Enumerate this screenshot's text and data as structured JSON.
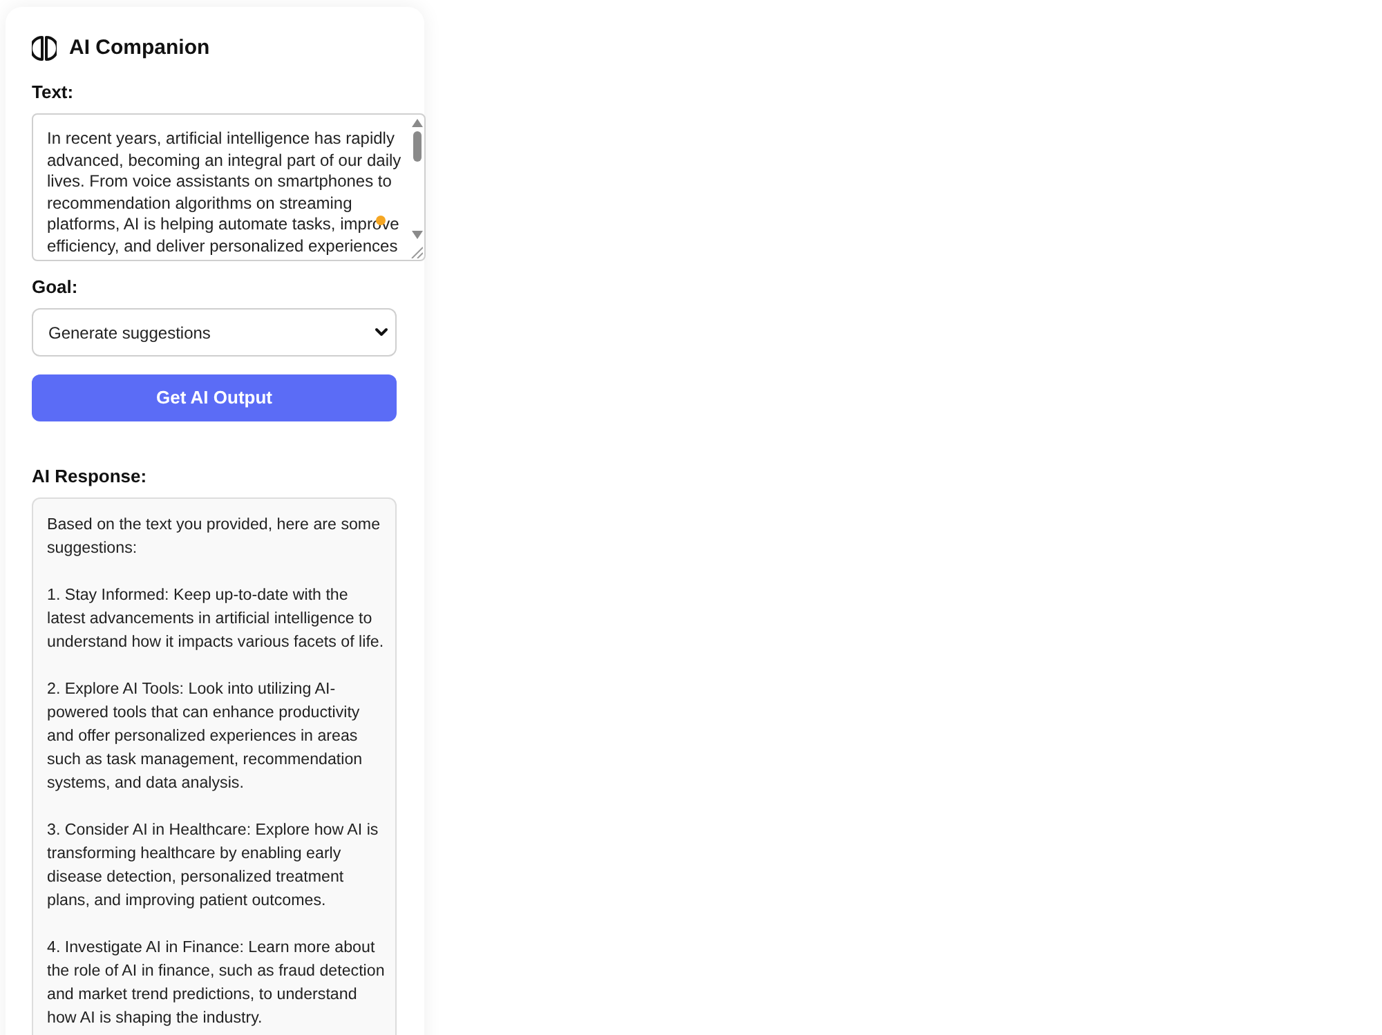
{
  "app": {
    "title": "AI Companion"
  },
  "text_field": {
    "label": "Text:",
    "value": "In recent years, artificial intelligence has rapidly advanced, becoming an integral part of our daily lives. From voice assistants on smartphones to recommendation algorithms on streaming platforms, AI is helping automate tasks, improve efficiency, and deliver personalized experiences"
  },
  "goal_select": {
    "label": "Goal:",
    "value": "Generate suggestions"
  },
  "submit_button": {
    "label": "Get AI Output"
  },
  "response": {
    "title": "AI Response:",
    "paragraphs": [
      "Based on the text you provided, here are some suggestions:",
      "1. Stay Informed: Keep up-to-date with the latest advancements in artificial intelligence to understand how it impacts various facets of life.",
      "2. Explore AI Tools: Look into utilizing AI-powered tools that can enhance productivity and offer personalized experiences in areas such as task management, recommendation systems, and data analysis.",
      "3. Consider AI in Healthcare: Explore how AI is transforming healthcare by enabling early disease detection, personalized treatment plans, and improving patient outcomes.",
      "4. Investigate AI in Finance: Learn more about the role of AI in finance, such as fraud detection and market trend predictions, to understand how AI is shaping the industry."
    ]
  }
}
